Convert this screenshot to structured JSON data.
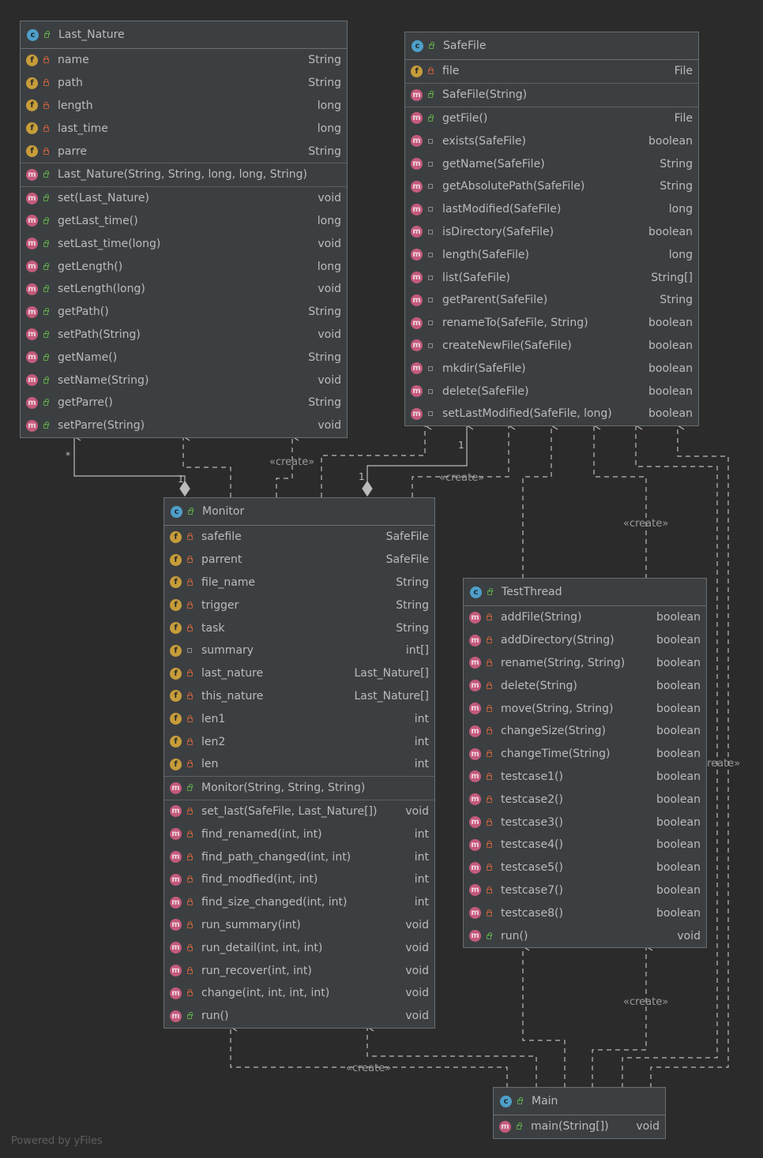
{
  "classes": {
    "last_nature": {
      "name": "Last_Nature",
      "fields": [
        {
          "name": "name",
          "type": "String",
          "vis": "priv"
        },
        {
          "name": "path",
          "type": "String",
          "vis": "priv"
        },
        {
          "name": "length",
          "type": "long",
          "vis": "priv"
        },
        {
          "name": "last_time",
          "type": "long",
          "vis": "priv"
        },
        {
          "name": "parre",
          "type": "String",
          "vis": "priv"
        }
      ],
      "constructors": [
        {
          "name": "Last_Nature(String, String, long, long, String)",
          "type": "",
          "vis": "pub"
        }
      ],
      "methods": [
        {
          "name": "set(Last_Nature)",
          "type": "void",
          "vis": "pub"
        },
        {
          "name": "getLast_time()",
          "type": "long",
          "vis": "pub"
        },
        {
          "name": "setLast_time(long)",
          "type": "void",
          "vis": "pub"
        },
        {
          "name": "getLength()",
          "type": "long",
          "vis": "pub"
        },
        {
          "name": "setLength(long)",
          "type": "void",
          "vis": "pub"
        },
        {
          "name": "getPath()",
          "type": "String",
          "vis": "pub"
        },
        {
          "name": "setPath(String)",
          "type": "void",
          "vis": "pub"
        },
        {
          "name": "getName()",
          "type": "String",
          "vis": "pub"
        },
        {
          "name": "setName(String)",
          "type": "void",
          "vis": "pub"
        },
        {
          "name": "getParre()",
          "type": "String",
          "vis": "pub"
        },
        {
          "name": "setParre(String)",
          "type": "void",
          "vis": "pub"
        }
      ]
    },
    "safefile": {
      "name": "SafeFile",
      "fields": [
        {
          "name": "file",
          "type": "File",
          "vis": "priv"
        }
      ],
      "constructors": [
        {
          "name": "SafeFile(String)",
          "type": "",
          "vis": "pub"
        }
      ],
      "methods": [
        {
          "name": "getFile()",
          "type": "File",
          "vis": "pub"
        },
        {
          "name": "exists(SafeFile)",
          "type": "boolean",
          "vis": "pkg"
        },
        {
          "name": "getName(SafeFile)",
          "type": "String",
          "vis": "pkg"
        },
        {
          "name": "getAbsolutePath(SafeFile)",
          "type": "String",
          "vis": "pkg"
        },
        {
          "name": "lastModified(SafeFile)",
          "type": "long",
          "vis": "pkg"
        },
        {
          "name": "isDirectory(SafeFile)",
          "type": "boolean",
          "vis": "pkg"
        },
        {
          "name": "length(SafeFile)",
          "type": "long",
          "vis": "pkg"
        },
        {
          "name": "list(SafeFile)",
          "type": "String[]",
          "vis": "pkg"
        },
        {
          "name": "getParent(SafeFile)",
          "type": "String",
          "vis": "pkg"
        },
        {
          "name": "renameTo(SafeFile, String)",
          "type": "boolean",
          "vis": "pkg"
        },
        {
          "name": "createNewFile(SafeFile)",
          "type": "boolean",
          "vis": "pkg"
        },
        {
          "name": "mkdir(SafeFile)",
          "type": "boolean",
          "vis": "pkg"
        },
        {
          "name": "delete(SafeFile)",
          "type": "boolean",
          "vis": "pkg"
        },
        {
          "name": "setLastModified(SafeFile, long)",
          "type": "boolean",
          "vis": "pkg"
        }
      ]
    },
    "monitor": {
      "name": "Monitor",
      "fields": [
        {
          "name": "safefile",
          "type": "SafeFile",
          "vis": "priv"
        },
        {
          "name": "parrent",
          "type": "SafeFile",
          "vis": "priv"
        },
        {
          "name": "file_name",
          "type": "String",
          "vis": "priv"
        },
        {
          "name": "trigger",
          "type": "String",
          "vis": "priv"
        },
        {
          "name": "task",
          "type": "String",
          "vis": "priv"
        },
        {
          "name": "summary",
          "type": "int[]",
          "vis": "pkg"
        },
        {
          "name": "last_nature",
          "type": "Last_Nature[]",
          "vis": "priv"
        },
        {
          "name": "this_nature",
          "type": "Last_Nature[]",
          "vis": "priv"
        },
        {
          "name": "len1",
          "type": "int",
          "vis": "priv"
        },
        {
          "name": "len2",
          "type": "int",
          "vis": "priv"
        },
        {
          "name": "len",
          "type": "int",
          "vis": "priv"
        }
      ],
      "constructors": [
        {
          "name": "Monitor(String, String, String)",
          "type": "",
          "vis": "pub"
        }
      ],
      "methods": [
        {
          "name": "set_last(SafeFile, Last_Nature[])",
          "type": "void",
          "vis": "priv"
        },
        {
          "name": "find_renamed(int, int)",
          "type": "int",
          "vis": "priv"
        },
        {
          "name": "find_path_changed(int, int)",
          "type": "int",
          "vis": "priv"
        },
        {
          "name": "find_modfied(int, int)",
          "type": "int",
          "vis": "priv"
        },
        {
          "name": "find_size_changed(int, int)",
          "type": "int",
          "vis": "priv"
        },
        {
          "name": "run_summary(int)",
          "type": "void",
          "vis": "priv"
        },
        {
          "name": "run_detail(int, int, int)",
          "type": "void",
          "vis": "priv"
        },
        {
          "name": "run_recover(int, int)",
          "type": "void",
          "vis": "priv"
        },
        {
          "name": "change(int, int, int, int)",
          "type": "void",
          "vis": "priv"
        },
        {
          "name": "run()",
          "type": "void",
          "vis": "pub"
        }
      ]
    },
    "testthread": {
      "name": "TestThread",
      "methods": [
        {
          "name": "addFile(String)",
          "type": "boolean",
          "vis": "priv"
        },
        {
          "name": "addDirectory(String)",
          "type": "boolean",
          "vis": "priv"
        },
        {
          "name": "rename(String, String)",
          "type": "boolean",
          "vis": "priv"
        },
        {
          "name": "delete(String)",
          "type": "boolean",
          "vis": "priv"
        },
        {
          "name": "move(String, String)",
          "type": "boolean",
          "vis": "priv"
        },
        {
          "name": "changeSize(String)",
          "type": "boolean",
          "vis": "priv"
        },
        {
          "name": "changeTime(String)",
          "type": "boolean",
          "vis": "priv"
        },
        {
          "name": "testcase1()",
          "type": "boolean",
          "vis": "priv"
        },
        {
          "name": "testcase2()",
          "type": "boolean",
          "vis": "priv"
        },
        {
          "name": "testcase3()",
          "type": "boolean",
          "vis": "priv"
        },
        {
          "name": "testcase4()",
          "type": "boolean",
          "vis": "priv"
        },
        {
          "name": "testcase5()",
          "type": "boolean",
          "vis": "priv"
        },
        {
          "name": "testcase7()",
          "type": "boolean",
          "vis": "priv"
        },
        {
          "name": "testcase8()",
          "type": "boolean",
          "vis": "priv"
        },
        {
          "name": "run()",
          "type": "void",
          "vis": "pub"
        }
      ]
    },
    "main": {
      "name": "Main",
      "methods": [
        {
          "name": "main(String[])",
          "type": "void",
          "vis": "pub"
        }
      ]
    }
  },
  "labels": {
    "create": "«create»",
    "mult_star": "*",
    "mult_one": "1"
  },
  "footer": "Powered by yFiles",
  "colors": {
    "background": "#2b2b2b",
    "box": "#3c3f41",
    "border": "#6a6e71",
    "edge": "#a9b7c6",
    "class_badge": "#4e9fc9",
    "field_badge": "#c79d3a",
    "method_badge": "#c45a7c"
  }
}
